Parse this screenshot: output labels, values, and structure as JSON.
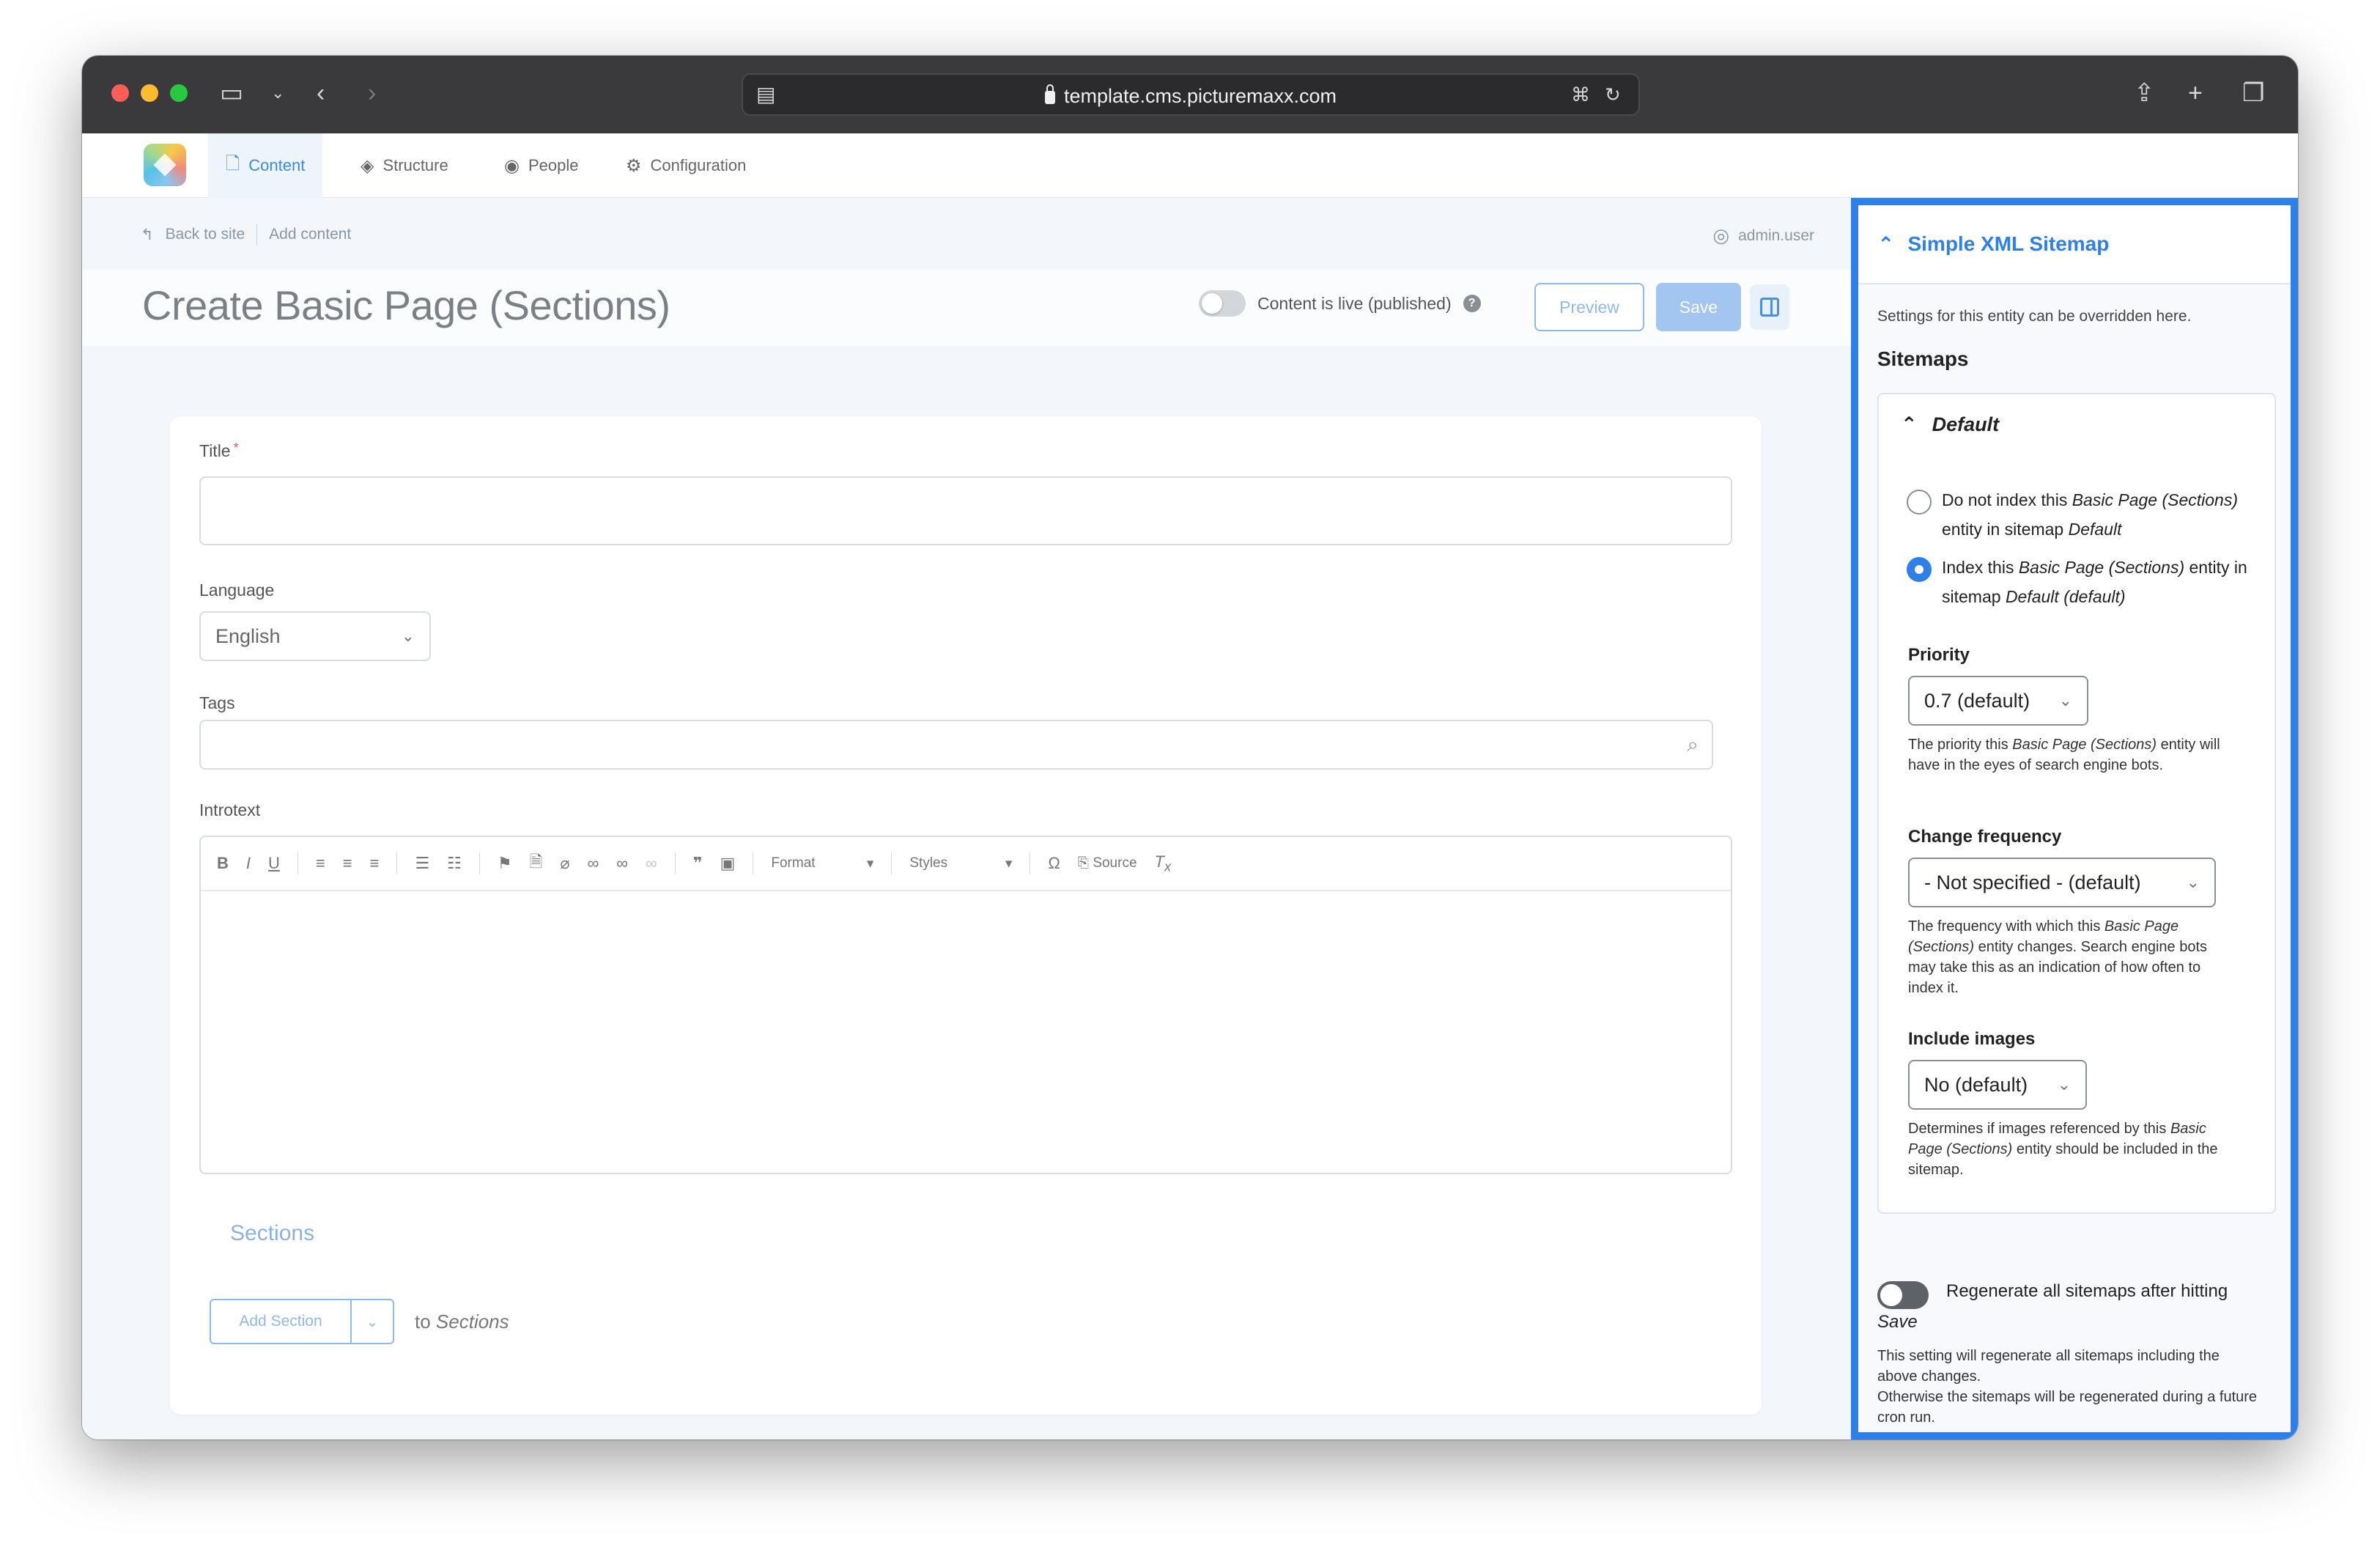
{
  "browser": {
    "url": "template.cms.picturemaxx.com"
  },
  "nav": {
    "tabs": [
      {
        "label": "Content",
        "icon": "file-icon",
        "active": true
      },
      {
        "label": "Structure",
        "icon": "layers-icon",
        "active": false
      },
      {
        "label": "People",
        "icon": "user-circle-icon",
        "active": false
      },
      {
        "label": "Configuration",
        "icon": "gear-icon",
        "active": false
      }
    ]
  },
  "breadcrumb": {
    "back": "Back to site",
    "current": "Add content",
    "user": "admin.user"
  },
  "header": {
    "title": "Create Basic Page (Sections)",
    "live_label": "Content is live (published)",
    "preview": "Preview",
    "save": "Save"
  },
  "form": {
    "title_label": "Title",
    "title_value": "",
    "language_label": "Language",
    "language_value": "English",
    "tags_label": "Tags",
    "introtext_label": "Introtext",
    "toolbar": {
      "format": "Format",
      "styles": "Styles",
      "source": "Source"
    },
    "sections_title": "Sections",
    "add_section": "Add Section",
    "to_prefix": "to",
    "to_target": "Sections"
  },
  "sidebar": {
    "title": "Simple XML Sitemap",
    "note": "Settings for this entity can be overridden here.",
    "sitemaps_heading": "Sitemaps",
    "default_heading": "Default",
    "options": {
      "no_index": {
        "prefix": "Do not index this",
        "entity": "Basic Page (Sections)",
        "mid": "entity in sitemap",
        "sitemap": "Default"
      },
      "index": {
        "prefix": "Index this",
        "entity": "Basic Page (Sections)",
        "mid": "entity in sitemap",
        "sitemap": "Default (default)",
        "selected": true
      }
    },
    "priority": {
      "label": "Priority",
      "value": "0.7 (default)",
      "desc_prefix": "The priority this",
      "desc_entity": "Basic Page (Sections)",
      "desc_suffix": "entity will have in the eyes of search engine bots."
    },
    "change_frequency": {
      "label": "Change frequency",
      "value": "- Not specified - (default)",
      "desc_prefix": "The frequency with which this",
      "desc_entity": "Basic Page (Sections)",
      "desc_suffix": "entity changes. Search engine bots may take this as an indication of how often to index it."
    },
    "include_images": {
      "label": "Include images",
      "value": "No (default)",
      "desc_prefix": "Determines if images referenced by this",
      "desc_entity": "Basic Page (Sections)",
      "desc_suffix": "entity should be included in the sitemap."
    },
    "regenerate": {
      "label": "Regenerate all sitemaps after hitting",
      "save_word": "Save",
      "desc1": "This setting will regenerate all sitemaps including the above changes.",
      "desc2": "Otherwise the sitemaps will be regenerated during a future cron run."
    }
  }
}
